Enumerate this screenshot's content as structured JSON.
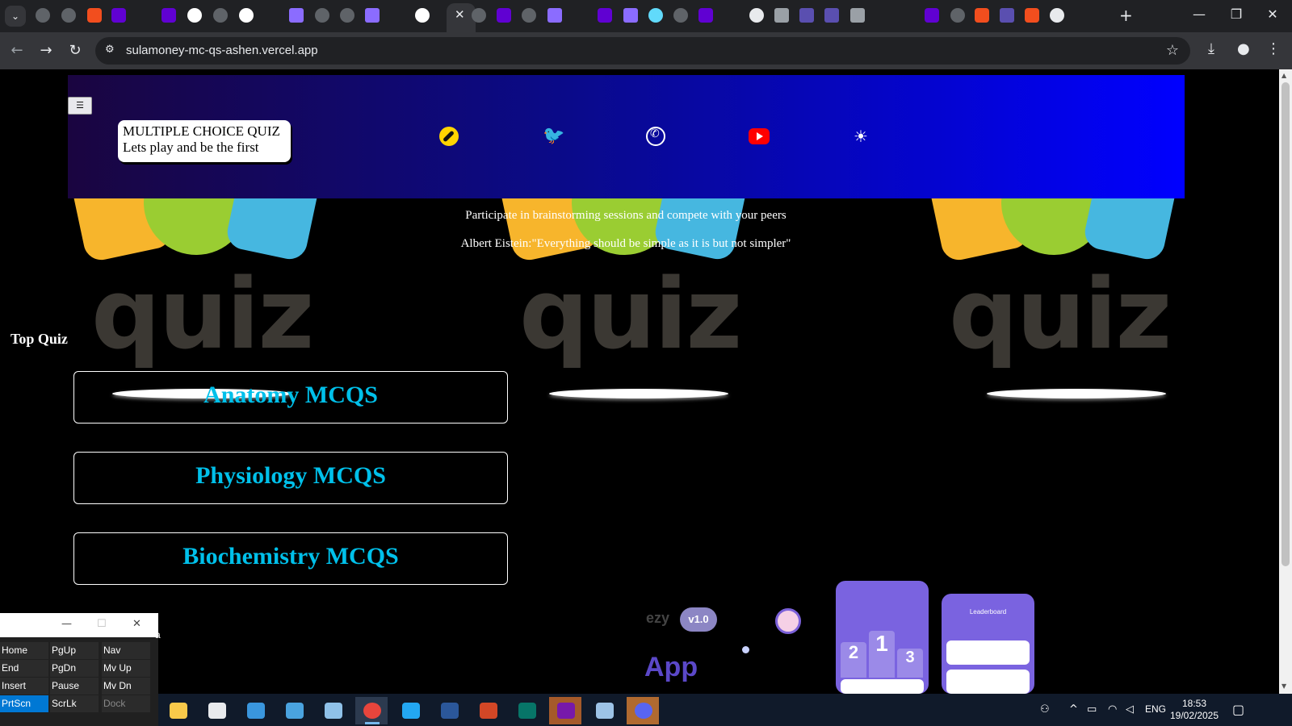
{
  "browser": {
    "url": "sulamoney-mc-qs-ashen.vercel.app",
    "active_tab_close": "✕",
    "new_tab": "+",
    "window_controls": {
      "minimize": "—",
      "restore": "❐",
      "close": "✕"
    }
  },
  "header": {
    "menu_icon": "list-icon",
    "brand_title": "MULTIPLE CHOICE QUIZ",
    "brand_subtitle": "Lets play and be the first",
    "social_icons": [
      "compass-icon",
      "twitter-icon",
      "whatsapp-icon",
      "youtube-icon",
      "sun-icon"
    ],
    "colors": {
      "gradient_start": "#1a0540",
      "gradient_end": "#0000ff"
    }
  },
  "hero": {
    "tagline": "Participate in brainstorming sessions and compete with your peers",
    "quote": "Albert Eistein:\"Everything should be simple as it is but not simpler\"",
    "background_word": "quiz"
  },
  "top_quiz": {
    "title": "Top Quiz",
    "items": [
      {
        "label": "Anatomy MCQS"
      },
      {
        "label": "Physiology MCQS"
      },
      {
        "label": "Biochemistry MCQS"
      }
    ],
    "accent_color": "#00c0ea"
  },
  "promo": {
    "version": "v1.0",
    "text_left": "ezy",
    "app_text": "App",
    "phone2_title": "Leaderboard",
    "podium": [
      "2",
      "1",
      "3"
    ]
  },
  "osk": {
    "keys": [
      [
        "Home",
        "PgUp",
        "Nav"
      ],
      [
        "End",
        "PgDn",
        "Mv Up"
      ],
      [
        "Insert",
        "Pause",
        "Mv Dn"
      ],
      [
        "PrtScn",
        "ScrLk",
        "Dock"
      ]
    ],
    "side_letter": "a"
  },
  "taskbar": {
    "language": "ENG",
    "time": "18:53",
    "date": "19/02/2025"
  }
}
